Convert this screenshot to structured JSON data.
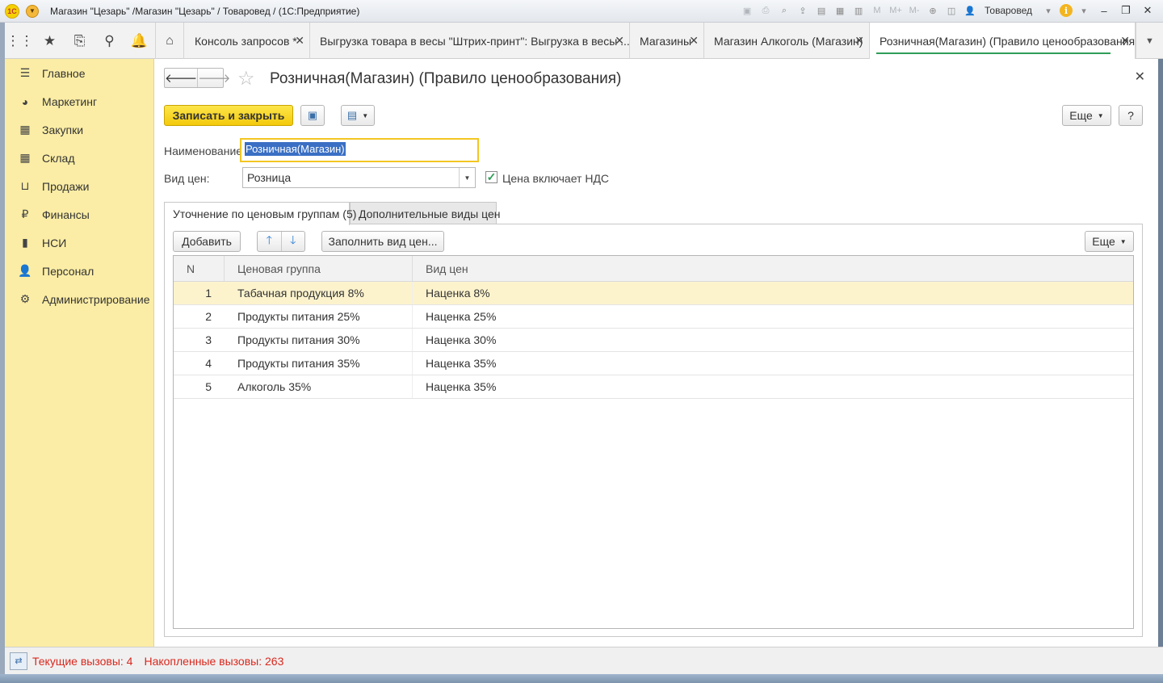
{
  "window": {
    "title": "Магазин \"Цезарь\" /Магазин \"Цезарь\" / Товаровед /  (1С:Предприятие)",
    "logo_text": "1С",
    "user": "Товаровед",
    "toolbar_m": "M",
    "toolbar_mplus": "M+",
    "toolbar_mminus": "M-"
  },
  "tabs": [
    {
      "label": "Консоль запросов *"
    },
    {
      "label": "Выгрузка товара в весы \"Штрих-принт\": Выгрузка в весы ..."
    },
    {
      "label": "Магазины"
    },
    {
      "label": "Магазин Алкоголь (Магазин)"
    },
    {
      "label": "Розничная(Магазин) (Правило ценообразования)"
    }
  ],
  "sidebar": {
    "items": [
      {
        "label": "Главное",
        "icon": "menu-icon"
      },
      {
        "label": "Маркетинг",
        "icon": "pie-chart-icon"
      },
      {
        "label": "Закупки",
        "icon": "cart-icon"
      },
      {
        "label": "Склад",
        "icon": "warehouse-icon"
      },
      {
        "label": "Продажи",
        "icon": "basket-icon"
      },
      {
        "label": "Финансы",
        "icon": "ruble-icon"
      },
      {
        "label": "НСИ",
        "icon": "books-icon"
      },
      {
        "label": "Персонал",
        "icon": "person-icon"
      },
      {
        "label": "Администрирование",
        "icon": "gear-icon"
      }
    ]
  },
  "form": {
    "title": "Розничная(Магазин) (Правило ценообразования)",
    "save_close_label": "Записать и закрыть",
    "more_label": "Еще",
    "help_label": "?",
    "name_label": "Наименование:",
    "name_value": "Розничная(Магазин)",
    "price_type_label": "Вид цен:",
    "price_type_value": "Розница",
    "vat_label": "Цена включает НДС",
    "vat_checked": true
  },
  "page_tabs": [
    {
      "label": "Уточнение по ценовым группам (5)"
    },
    {
      "label": "Дополнительные виды цен"
    }
  ],
  "table_toolbar": {
    "add_label": "Добавить",
    "fill_label": "Заполнить вид цен...",
    "more_label": "Еще"
  },
  "table": {
    "headers": [
      "N",
      "Ценовая группа",
      "Вид цен"
    ],
    "rows": [
      {
        "n": "1",
        "group": "Табачная продукция 8%",
        "price": "Наценка 8%"
      },
      {
        "n": "2",
        "group": "Продукты питания 25%",
        "price": "Наценка 25%"
      },
      {
        "n": "3",
        "group": "Продукты питания 30%",
        "price": "Наценка 30%"
      },
      {
        "n": "4",
        "group": "Продукты питания 35%",
        "price": "Наценка 35%"
      },
      {
        "n": "5",
        "group": "Алкоголь 35%",
        "price": "Наценка 35%"
      }
    ],
    "selected_row": 1
  },
  "status": {
    "current_calls": "Текущие вызовы: 4",
    "accumulated_calls": "Накопленные вызовы: 263"
  },
  "colors": {
    "sidebar_bg": "#fbeda5",
    "primary_button": "#f3c90b",
    "selected_row": "#fcf3cd",
    "status_text": "#d9281e",
    "active_tab_underline": "#2e9e57"
  }
}
